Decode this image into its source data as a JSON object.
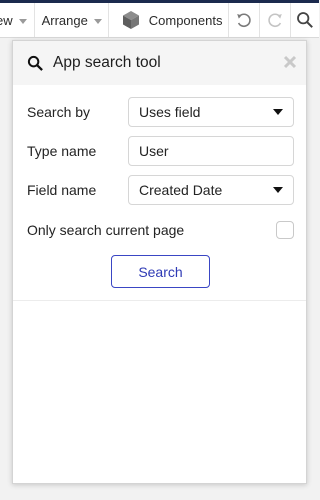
{
  "toolbar": {
    "view_label": "ew",
    "arrange_label": "Arrange",
    "components_label": "Components",
    "icons": [
      "caret-down-icon",
      "cube-icon",
      "undo-icon",
      "redo-icon",
      "search-icon"
    ],
    "brand_color": "#1b2a4e"
  },
  "panel": {
    "title": "App search tool",
    "fields": {
      "search_by": {
        "label": "Search by",
        "value": "Uses field"
      },
      "type_name": {
        "label": "Type name",
        "value": "User"
      },
      "field_name": {
        "label": "Field name",
        "value": "Created Date"
      },
      "current_page": {
        "label": "Only search current page",
        "checked": false
      }
    },
    "search_button": "Search",
    "accent_color": "#2e3ab5"
  }
}
